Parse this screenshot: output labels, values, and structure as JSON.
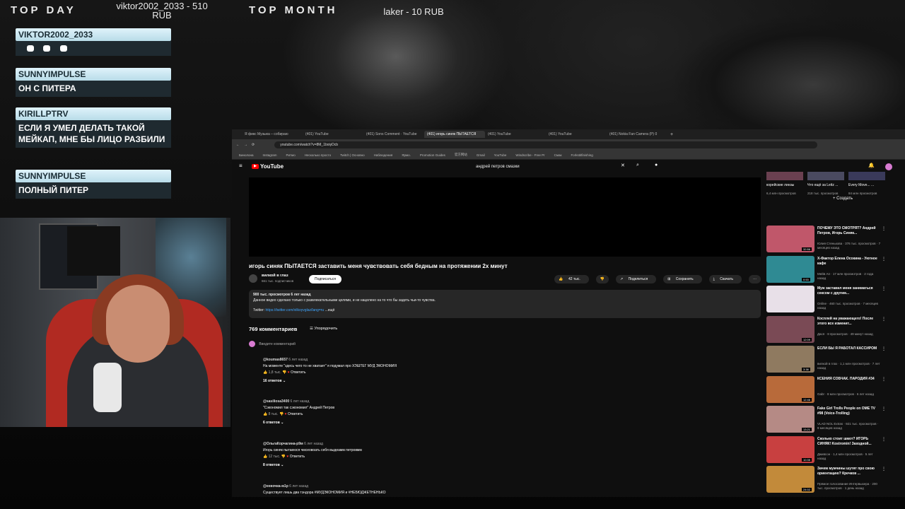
{
  "overlay": {
    "top_day_label": "TOP DAY",
    "top_day_value": "viktor2002_2033 - 510 RUB",
    "top_month_label": "TOP MONTH",
    "top_month_value": "laker - 10 RUB"
  },
  "chat": [
    {
      "nick": "VIKTOR2002_2033",
      "text": ""
    },
    {
      "nick": "SUNNYIMPULSE",
      "text": "ОН С ПИТЕРА"
    },
    {
      "nick": "KIRILLPTRV",
      "text": "ЕСЛИ Я УМЕЛ ДЕЛАТЬ ТАКОЙ МЕЙКАП, МНЕ БЫ ЛИЦО РАЗБИЛИ"
    },
    {
      "nick": "SUNNYIMPULSE",
      "text": "ПОЛНЫЙ ПИТЕР"
    }
  ],
  "browser": {
    "tabs": [
      "Я фикс Музыка – собираю",
      "(401) YouTube",
      "(401) Sons Comment · YouTube",
      "(401) игорь синяк ПЫТАЕТСЯ",
      "(401) YouTube",
      "(401) YouTube",
      "(401) Nokia Fan Camera (P) 0"
    ],
    "url": "youtube.com/watch?v=8M_1boiyDcb",
    "bookmarks": [
      "Бинолона",
      "Instagram",
      "Ритмо",
      "Несколько просто",
      "Twitch | Основнo",
      "Наблюдения",
      "Ярмо.",
      "Promotion Guides",
      "官方网站",
      "Gmail",
      "YouTube",
      "Windscribe - Free Pr",
      "Смак",
      "Forkstitfinishing"
    ]
  },
  "youtube": {
    "logo": "YouTube",
    "search_query": "андрей петров смазки",
    "create_label": "Создать",
    "video_title": "игорь синяк ПЫТАЕТСЯ заставить меня чувствовать себя бедным на протяжении 2х минут",
    "channel_name": "вилкой в глаз",
    "channel_subs": "661 тыс. подписчиков",
    "subscribe_label": "Подписаться",
    "likes": "42 тыс.",
    "share_label": "Поделиться",
    "save_label": "Сохранить",
    "download_label": "Скачать",
    "desc_meta": "900 тыс. просмотров  6 лет назад",
    "desc_text": "Данное видео сделано только с развлекательными целями, и не нацелено на то что бы задеть чьи-то чувства.",
    "desc_link_prefix": "Twitter:",
    "desc_link": "https://twitter.com/vilkoyvglaz/lang=ru",
    "desc_more": "...ещё",
    "comments_count": "769 комментариев",
    "sort_label": "Упорядочить",
    "add_comment_placeholder": "Введите комментарий",
    "comments": [
      {
        "author": "@koumas8657",
        "when": "6 лет назад",
        "text": "На моменте \"здесь чего то не хватает\" я подумал про ХЭШТЕГ МУД ЭКОНОМИЯ",
        "likes": "1,8 тыс.",
        "reply": "Ответить",
        "replies": "16 ответов"
      },
      {
        "author": "@sasiliosa3400",
        "when": "6 лет назад",
        "text": "\"Сэкономил так сэкономил\"     Андрей Петров",
        "likes": "8 тыс.",
        "reply": "Ответить",
        "replies": "6 ответов"
      },
      {
        "author": "@ОльгаКорчагина-р9м",
        "when": "6 лет назад",
        "text": "Игорь  синяк пытаеюся    чмсеовоать   себя выдеамм   петровмм",
        "likes": "12 тыс.",
        "reply": "Ответить",
        "replies": "8 ответов"
      },
      {
        "author": "@еевочка-м1р",
        "when": "6 лет назад",
        "text": "Существует лишь два тэндора #МУДЭКОНОМИЯ и #НЕБЮДЖЕТНЕНЬКО",
        "likes": "",
        "reply": "",
        "replies": ""
      }
    ],
    "recommendations_top": [
      {
        "title": "корейские линзы",
        "meta": "6,4 млн просмотров"
      },
      {
        "title": "Что ещё за Leitz ...",
        "meta": "218 тыс. просмотров"
      },
      {
        "title": "Every Move... ...",
        "meta": "84 млн просмотров"
      }
    ],
    "recommendations": [
      {
        "title": "ПОЧЕМУ ЭТО СМОТРЯТ? Андрей Петров, Игорь Синяк...",
        "meta": "Юлия Стенькова · 376 тыс. просмотров · 7 месяцев назад",
        "duration": "32:56",
        "color": "#c0576a"
      },
      {
        "title": "X-Фактор Елена Осокина - Уютное кафе",
        "meta": "Мейв Ап · 17 млн просмотров · 2 года назад",
        "duration": "0:53",
        "color": "#2f8a93"
      },
      {
        "title": "Муж заставил меня заниматься сексом с другим...",
        "meta": "Online · 460 тыс. просмотров · 7 месяцев назад",
        "duration": "",
        "color": "#e8e0e8"
      },
      {
        "title": "Косплей на уважающего! После этого все изменит...",
        "meta": "Дася · 8 просмотров · 49 минут назад",
        "duration": "12:09",
        "color": "#7a4a55"
      },
      {
        "title": "ЕСЛИ БЫ Я РАБОТАЛ КАССИРОМ",
        "meta": "вилкой в глаз · 1,1 млн просмотров · 7 лет назад",
        "duration": "3:38",
        "color": "#8f7a60"
      },
      {
        "title": "КСЕНИЯ СОБЧАК. ПАРОДИЯ #34",
        "meta": "Gabr · 8 млн просмотров · 6 лет назад",
        "duration": "12:46",
        "color": "#b86a3a"
      },
      {
        "title": "Fake Girl Trolls People on OME TV #98 (Voice-Trolling)",
        "meta": "VLAD NOL Extras · 921 тыс. просмотров · 9 месяцев назад",
        "duration": "13:21",
        "color": "#b58a85"
      },
      {
        "title": "Сколько стоит шмот? ИГОРЬ СИНЯК! Kostromin! Заходной...",
        "meta": "Дживсон · 1,4 млн просмотров · 5 лет назад",
        "duration": "10:35",
        "color": "#c84040"
      },
      {
        "title": "Зачем мужчины шутят про свою ориентацию? Кречков ...",
        "meta": "Прямое голосование Интервьюера · 200 тыс. просмотров · 1 день назад",
        "duration": "24:02",
        "color": "#c28a3a"
      }
    ]
  }
}
